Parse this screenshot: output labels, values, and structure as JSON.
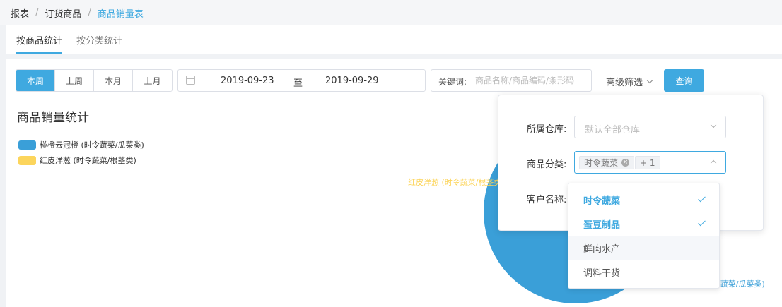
{
  "breadcrumb": {
    "items": [
      "报表",
      "订货商品",
      "商品销量表"
    ]
  },
  "tabs": [
    {
      "label": "按商品统计",
      "active": true
    },
    {
      "label": "按分类统计",
      "active": false
    }
  ],
  "toolbar": {
    "periods": [
      "本周",
      "上周",
      "本月",
      "上月"
    ],
    "active_period": "本周",
    "date_start": "2019-09-23",
    "date_to_label": "至",
    "date_end": "2019-09-29",
    "keyword_label": "关键词:",
    "keyword_placeholder": "商品名称/商品编码/条形码",
    "advanced_filter_label": "高级筛选",
    "query_button": "查询"
  },
  "chart": {
    "title": "商品销量统计"
  },
  "chart_data": {
    "type": "pie",
    "categories": [
      "椪橙云冠橙 (时令蔬菜/瓜菜类)",
      "红皮洋葱 (时令蔬菜/根茎类)"
    ],
    "values": [
      94,
      6
    ],
    "colors": [
      "#3a9fd8",
      "#fcd55c"
    ],
    "legend_position": "top-left",
    "slice_labels": [
      "椪橙云冠橙 (时令蔬菜/瓜菜类)",
      "红皮洋葱 (时令蔬菜/根茎类)"
    ]
  },
  "filter_panel": {
    "warehouse_label": "所属仓库:",
    "warehouse_placeholder": "默认全部仓库",
    "category_label": "商品分类:",
    "category_tag": "时令蔬菜",
    "category_more": "+ 1",
    "customer_label": "客户名称:"
  },
  "category_options": [
    {
      "label": "时令蔬菜",
      "selected": true,
      "hover": false
    },
    {
      "label": "蛋豆制品",
      "selected": true,
      "hover": false
    },
    {
      "label": "鲜肉水产",
      "selected": false,
      "hover": true
    },
    {
      "label": "调料干货",
      "selected": false,
      "hover": false
    }
  ],
  "colors": {
    "accent": "#3fa9e0",
    "pie_blue": "#3a9fd8",
    "pie_yellow": "#fcd55c"
  }
}
